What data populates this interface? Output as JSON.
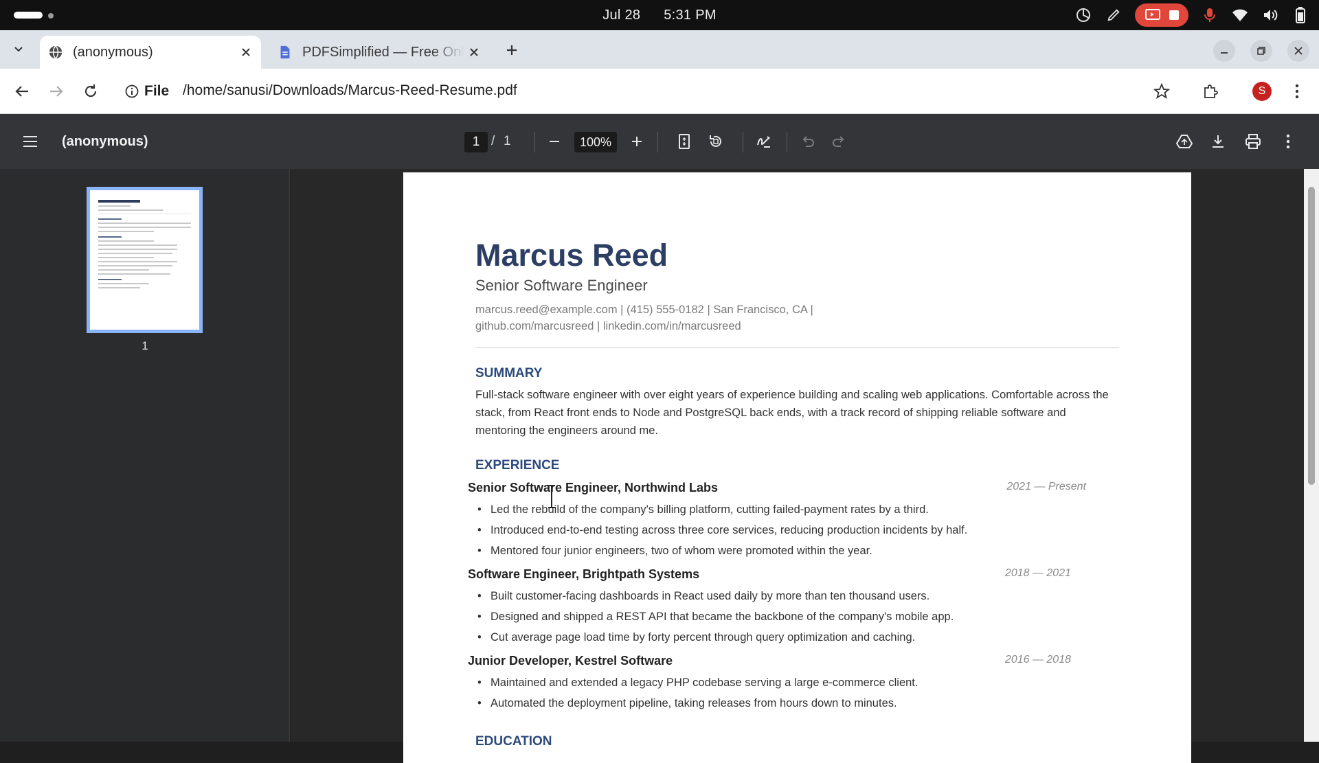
{
  "os": {
    "date": "Jul 28",
    "time": "5:31 PM"
  },
  "tabs": [
    {
      "title": "(anonymous)",
      "icon": "globe-icon",
      "active": true
    },
    {
      "title": "PDFSimplified — Free Online PDF Tools",
      "icon": "document-icon",
      "active": false
    }
  ],
  "address": {
    "scheme_label": "File",
    "url": "/home/sanusi/Downloads/Marcus-Reed-Resume.pdf",
    "profile_initial": "S"
  },
  "viewer": {
    "title": "(anonymous)",
    "current_page": "1",
    "separator": "/",
    "total_pages": "1",
    "zoom": "100%",
    "thumbnail_label": "1"
  },
  "resume": {
    "name": "Marcus Reed",
    "role": "Senior Software Engineer",
    "contact": "marcus.reed@example.com  |  (415) 555-0182  |  San Francisco, CA  |  github.com/marcusreed  |  linkedin.com/in/marcusreed",
    "summary_heading": "SUMMARY",
    "summary": "Full-stack software engineer with over eight years of experience building and scaling web applications. Comfortable across the stack, from React front ends to Node and PostgreSQL back ends, with a track record of shipping reliable software and mentoring the engineers around me.",
    "experience_heading": "EXPERIENCE",
    "jobs": [
      {
        "title": "Senior Software Engineer, Northwind Labs",
        "dates": "2021 — Present",
        "bullets": [
          "Led the rebuild of the company's billing platform, cutting failed-payment rates by a third.",
          "Introduced end-to-end testing across three core services, reducing production incidents by half.",
          "Mentored four junior engineers, two of whom were promoted within the year."
        ]
      },
      {
        "title": "Software Engineer, Brightpath Systems",
        "dates": "2018 — 2021",
        "bullets": [
          "Built customer-facing dashboards in React used daily by more than ten thousand users.",
          "Designed and shipped a REST API that became the backbone of the company's mobile app.",
          "Cut average page load time by forty percent through query optimization and caching."
        ]
      },
      {
        "title": "Junior Developer, Kestrel Software",
        "dates": "2016 — 2018",
        "bullets": [
          "Maintained and extended a legacy PHP codebase serving a large e-commerce client.",
          "Automated the deployment pipeline, taking releases from hours down to minutes."
        ]
      }
    ],
    "education_heading": "EDUCATION"
  },
  "colors": {
    "accent_heading": "#2c4a7c",
    "name_color": "#2c3e63",
    "record_button": "#e0463a",
    "profile_badge": "#c5221f",
    "thumbnail_selection": "#8ab4f8"
  }
}
